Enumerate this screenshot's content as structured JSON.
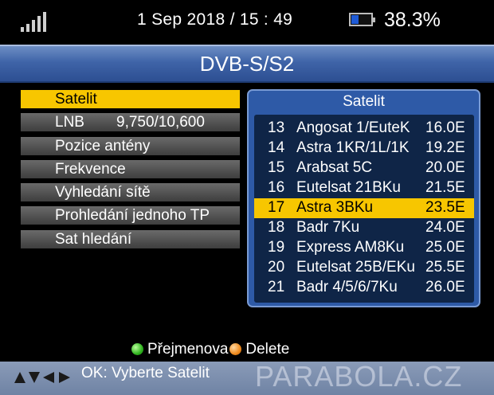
{
  "status": {
    "signal_icon": "signal-bars-icon",
    "datetime": "1 Sep 2018 / 15 : 49",
    "battery_icon": "battery-icon",
    "battery_level": 0.383,
    "battery_text": "38.3%"
  },
  "header": {
    "title": "DVB-S/S2"
  },
  "menu": {
    "items": [
      {
        "label": "Satelit",
        "value": "",
        "selected": true
      },
      {
        "label": "LNB",
        "value": "9,750/10,600",
        "selected": false
      },
      {
        "label": "Pozice antény",
        "value": "",
        "selected": false
      },
      {
        "label": "Frekvence",
        "value": "",
        "selected": false
      },
      {
        "label": "Vyhledání sítě",
        "value": "",
        "selected": false
      },
      {
        "label": "Prohledání jednoho TP",
        "value": "",
        "selected": false
      },
      {
        "label": "Sat hledání",
        "value": "",
        "selected": false
      }
    ]
  },
  "satellite_panel": {
    "title": "Satelit",
    "rows": [
      {
        "num": "13",
        "name": "Angosat 1/EuteK",
        "pos": "16.0E",
        "selected": false
      },
      {
        "num": "14",
        "name": "Astra 1KR/1L/1K",
        "pos": "19.2E",
        "selected": false
      },
      {
        "num": "15",
        "name": "Arabsat 5C",
        "pos": "20.0E",
        "selected": false
      },
      {
        "num": "16",
        "name": "Eutelsat 21BKu",
        "pos": "21.5E",
        "selected": false
      },
      {
        "num": "17",
        "name": "Astra 3BKu",
        "pos": "23.5E",
        "selected": true
      },
      {
        "num": "18",
        "name": "Badr 7Ku",
        "pos": "24.0E",
        "selected": false
      },
      {
        "num": "19",
        "name": "Express AM8Ku",
        "pos": "25.0E",
        "selected": false
      },
      {
        "num": "20",
        "name": "Eutelsat 25B/EKu",
        "pos": "25.5E",
        "selected": false
      },
      {
        "num": "21",
        "name": "Badr 4/5/6/7Ku",
        "pos": "26.0E",
        "selected": false
      }
    ]
  },
  "hints": {
    "green_icon": "green-button-icon",
    "green_label": "Přejmenova",
    "orange_icon": "orange-button-icon",
    "orange_label": "Delete"
  },
  "footer": {
    "arrows_icon": "direction-arrows-icon",
    "hint": "OK: Vyberte Satelit",
    "watermark": "PARABOLA.CZ"
  },
  "colors": {
    "highlight": "#f7c600",
    "title_bar": "#3f64a8",
    "panel": "#2e5aa7",
    "list_bg": "#0f2547"
  }
}
